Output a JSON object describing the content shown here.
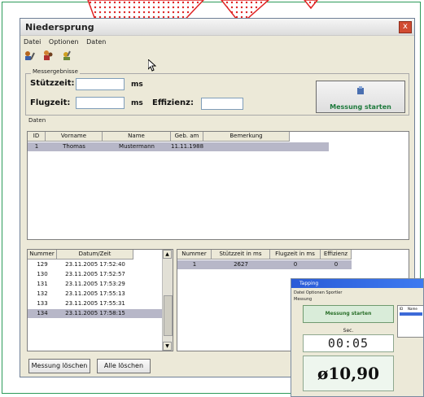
{
  "window": {
    "title": "Niedersprung",
    "close": "x"
  },
  "menu": [
    "Datei",
    "Optionen",
    "Daten"
  ],
  "messergebnisse": {
    "group_title": "Messergebnisse",
    "stuetzzeit_label": "Stützzeit:",
    "flugzeit_label": "Flugzeit:",
    "unit": "ms",
    "effizienz_label": "Effizienz:",
    "stuetzzeit_value": "",
    "flugzeit_value": "",
    "effizienz_value": ""
  },
  "start_button": {
    "label": "Messung starten"
  },
  "daten": {
    "group_title": "Daten",
    "columns": [
      "ID",
      "Vorname",
      "Name",
      "Geb. am",
      "Bemerkung"
    ],
    "rows": [
      {
        "id": "1",
        "vorname": "Thomas",
        "name": "Mustermann",
        "geb": "11.11.1988",
        "bemerkung": ""
      }
    ]
  },
  "messungen": {
    "columns": [
      "Nummer",
      "Datum/Zeit"
    ],
    "rows": [
      {
        "nummer": "129",
        "datum": "23.11.2005 17:52:40"
      },
      {
        "nummer": "130",
        "datum": "23.11.2005 17:52:57"
      },
      {
        "nummer": "131",
        "datum": "23.11.2005 17:53:29"
      },
      {
        "nummer": "132",
        "datum": "23.11.2005 17:55:13"
      },
      {
        "nummer": "133",
        "datum": "23.11.2005 17:55:31"
      },
      {
        "nummer": "134",
        "datum": "23.11.2005 17:58:15"
      }
    ]
  },
  "details": {
    "columns": [
      "Nummer",
      "Stützzeit in ms",
      "Flugzeit in ms",
      "Effizienz"
    ],
    "rows": [
      {
        "nummer": "1",
        "stuetz": "2627",
        "flug": "0",
        "eff": "0"
      }
    ]
  },
  "buttons": {
    "delete_measurement": "Messung löschen",
    "delete_all": "Alle löschen"
  },
  "tapping": {
    "title": "Tapping",
    "menu": "Datei  Optionen  Sportler",
    "group": "Messung",
    "start_label": "Messung starten",
    "sec_label": "Sec.",
    "timer": "00:05",
    "value": "ø10,90",
    "list_id": "ID",
    "list_name": "Name"
  },
  "colors": {
    "frame": "#2d9b5a",
    "accent_red": "#e02424",
    "selection": "#b7b7c8",
    "start_text": "#1d7a3c"
  }
}
